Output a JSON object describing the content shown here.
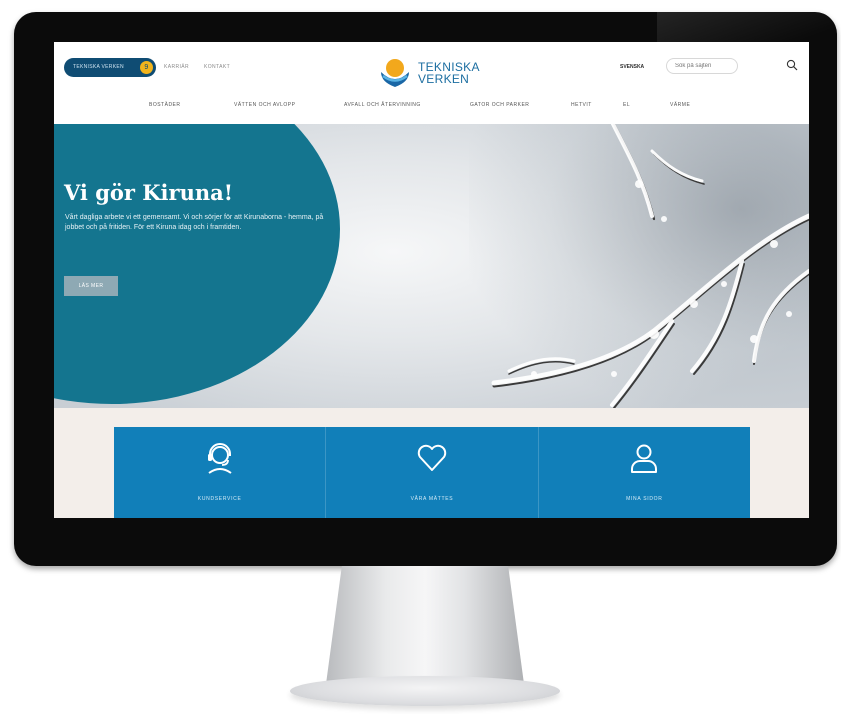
{
  "header": {
    "pill_label": "TEKNISKA VERKEN",
    "pill_badge": "9",
    "links": [
      "KARRIÄR",
      "KONTAKT"
    ],
    "logo_line1": "TEKNISKA",
    "logo_line2": "VERKEN",
    "language": "SVENSKA",
    "search_placeholder": "Sök på sajten"
  },
  "nav": {
    "items": [
      "BOSTÄDER",
      "VÄTTEN OCH AVLOPP",
      "AVFALL OCH ÅTERVINNING",
      "GATOR OCH PARKER",
      "HETVIT",
      "EL",
      "VÄRME"
    ]
  },
  "hero": {
    "title": "Vi gör Kiruna!",
    "text": "Vårt dagliga arbete vi ett gemensamt. Vi och sörjer för att Kirunaborna - hemma, på jobbet och på fritiden. För ett Kiruna idag och i framtiden.",
    "button_label": "LÄS MER"
  },
  "tiles": [
    {
      "icon": "headset-icon",
      "label": "KUNDSERVICE"
    },
    {
      "icon": "heart-icon",
      "label": "VÅRA MÄTTES"
    },
    {
      "icon": "user-icon",
      "label": "MINA SIDOR"
    }
  ],
  "colors": {
    "brand_blue": "#117fb9",
    "hero_teal": "#14758f",
    "pill_navy": "#0f4c73",
    "accent_yellow": "#f2b41c"
  }
}
